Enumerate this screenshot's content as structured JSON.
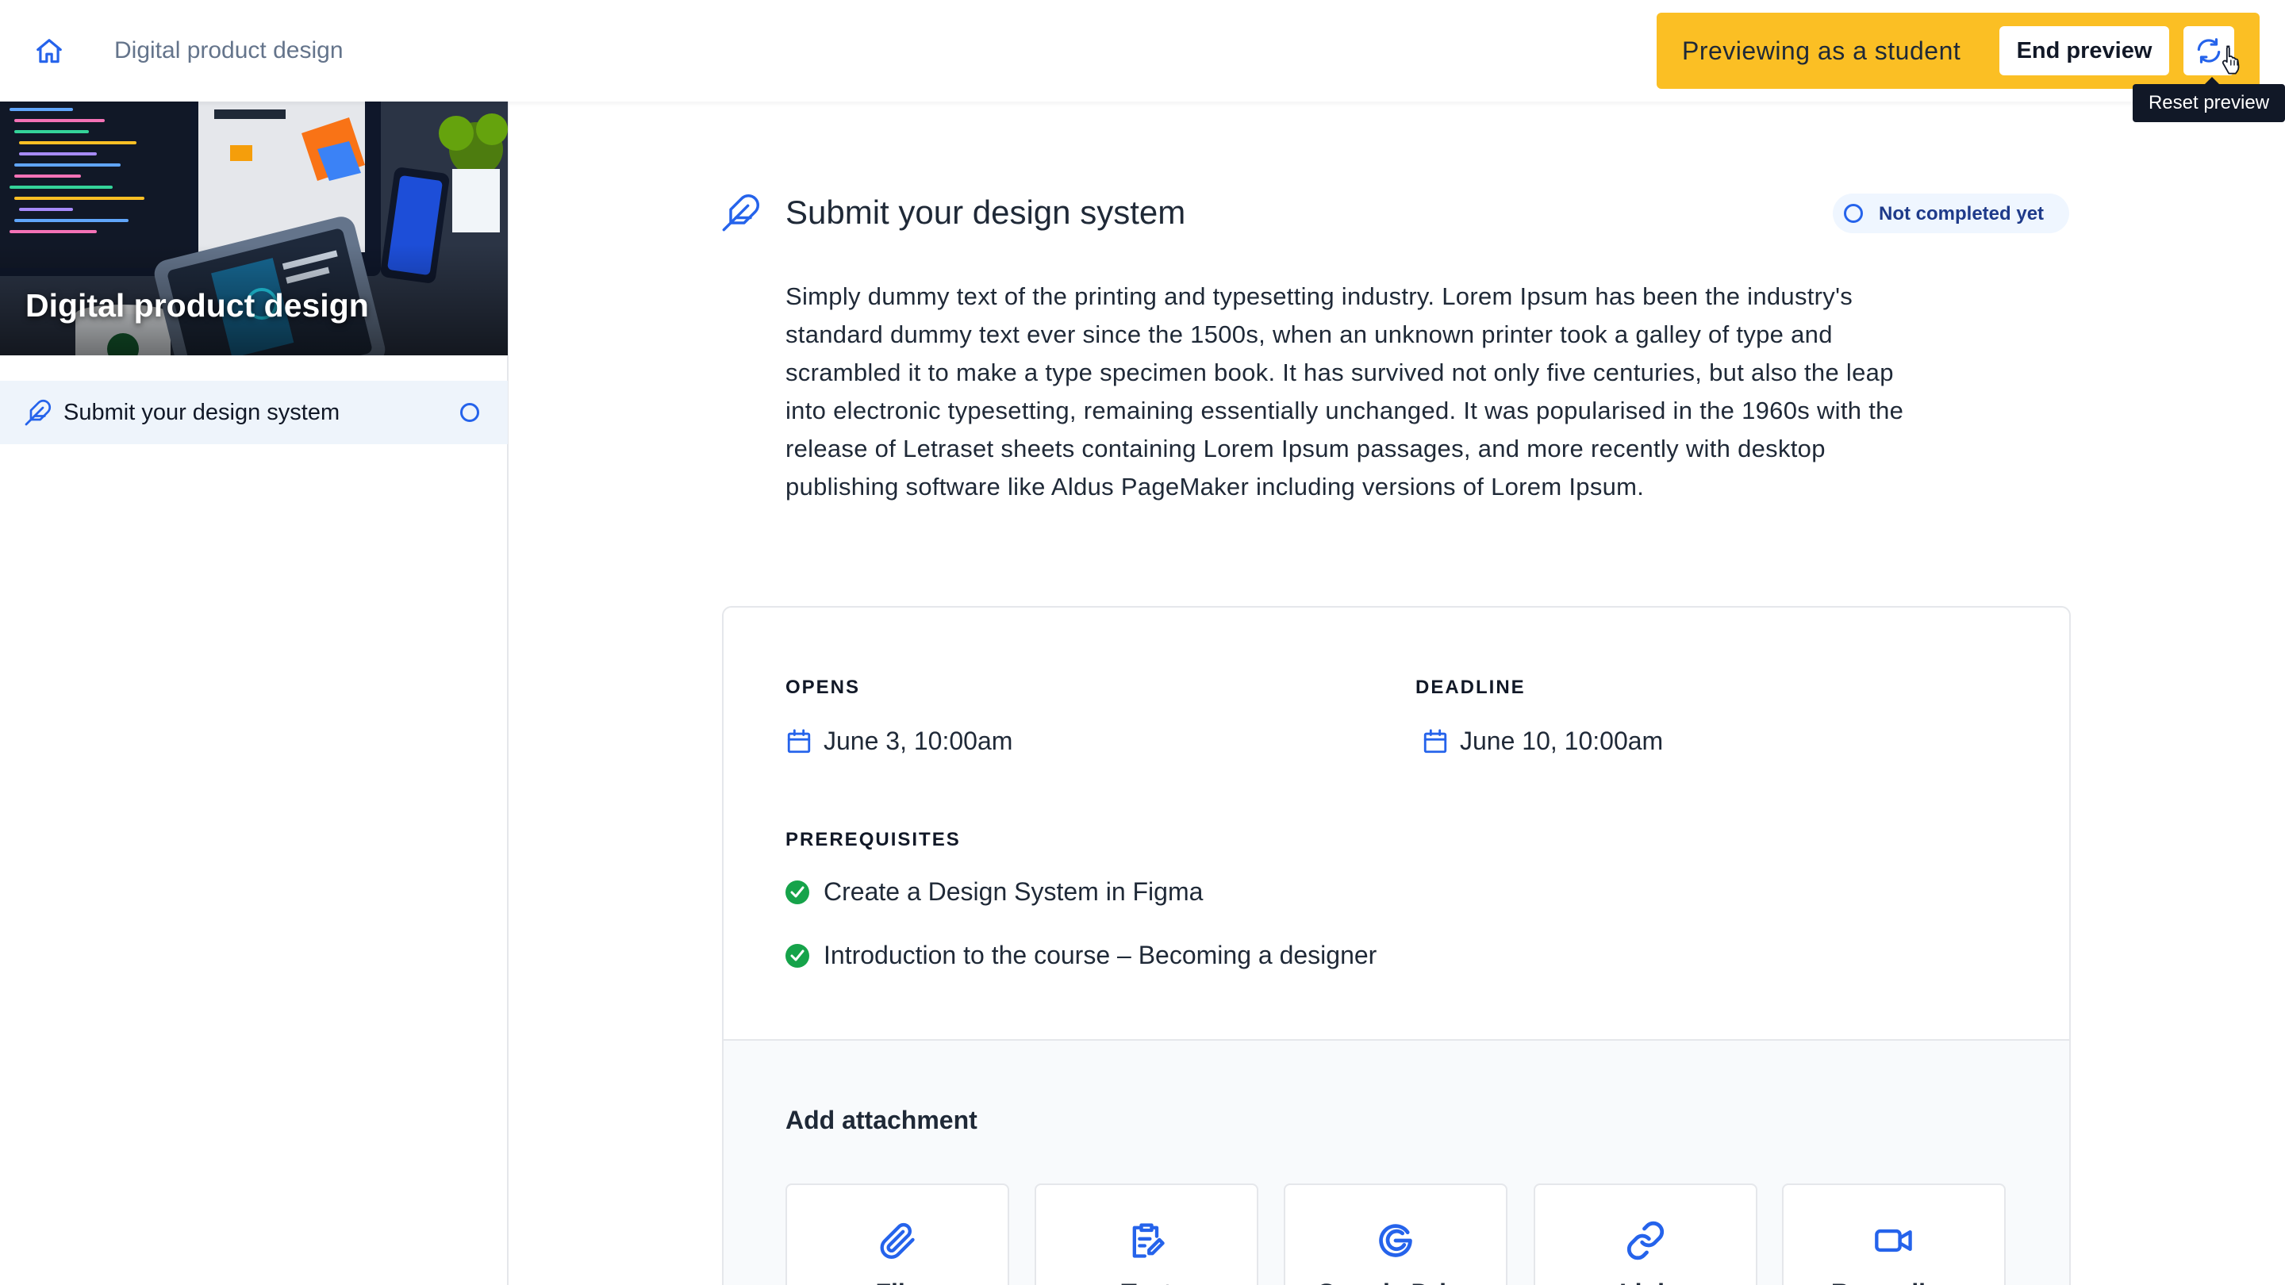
{
  "header": {
    "breadcrumb": "Digital product design",
    "preview_text": "Previewing as a student",
    "end_preview_label": "End preview",
    "reset_tooltip": "Reset preview"
  },
  "sidebar": {
    "course_title": "Digital product design",
    "items": [
      {
        "label": "Submit your design system",
        "status": "not-completed"
      }
    ]
  },
  "task": {
    "title": "Submit your design system",
    "status_label": "Not completed yet",
    "description": "Simply dummy text of the printing and typesetting industry. Lorem Ipsum has been the industry's standard dummy text ever since the 1500s, when an unknown printer took a galley of type and scrambled it to make a type specimen book. It has survived not only five centuries, but also the leap into electronic typesetting, remaining essentially unchanged. It was popularised in the 1960s with the release of Letraset sheets containing Lorem Ipsum passages, and more recently with desktop publishing software like Aldus PageMaker including versions of Lorem Ipsum."
  },
  "schedule": {
    "opens_label": "OPENS",
    "opens_value": "June 3, 10:00am",
    "deadline_label": "DEADLINE",
    "deadline_value": "June 10, 10:00am"
  },
  "prerequisites": {
    "label": "PREREQUISITES",
    "items": [
      "Create a Design System in Figma",
      "Introduction to the course – Becoming a designer"
    ]
  },
  "attachments": {
    "title": "Add attachment",
    "options": [
      {
        "label": "File",
        "icon": "paperclip-icon"
      },
      {
        "label": "Text",
        "icon": "edit-document-icon"
      },
      {
        "label": "Google Drive",
        "icon": "google-icon"
      },
      {
        "label": "Link",
        "icon": "link-icon"
      },
      {
        "label": "Recording",
        "icon": "video-camera-icon"
      }
    ]
  },
  "colors": {
    "accent": "#2563eb",
    "preview_banner": "#fbbf24",
    "success": "#16a34a",
    "sidebar_active": "#eef4fb"
  }
}
